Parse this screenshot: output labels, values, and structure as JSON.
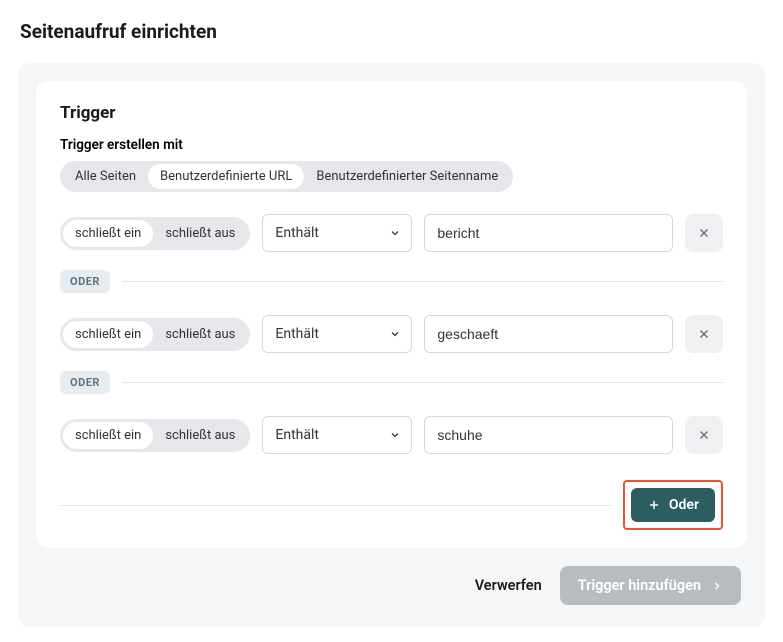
{
  "page_title": "Seitenaufruf einrichten",
  "card": {
    "title": "Trigger",
    "create_with_label": "Trigger erstellen mit",
    "modes": [
      {
        "label": "Alle Seiten",
        "active": false
      },
      {
        "label": "Benutzerdefinierte URL",
        "active": true
      },
      {
        "label": "Benutzerdefinierter Seitenname",
        "active": false
      }
    ]
  },
  "rules": [
    {
      "include": "schließt ein",
      "exclude": "schließt aus",
      "include_active": true,
      "operator": "Enthält",
      "value": "bericht"
    },
    {
      "include": "schließt ein",
      "exclude": "schließt aus",
      "include_active": true,
      "operator": "Enthält",
      "value": "geschaeft"
    },
    {
      "include": "schließt ein",
      "exclude": "schließt aus",
      "include_active": true,
      "operator": "Enthält",
      "value": "schuhe"
    }
  ],
  "or_label": "ODER",
  "add_or_label": "Oder",
  "footer": {
    "discard": "Verwerfen",
    "submit": "Trigger hinzufügen"
  }
}
